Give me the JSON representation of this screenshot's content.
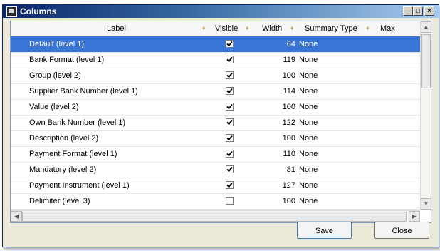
{
  "window": {
    "title": "Columns"
  },
  "grid": {
    "columns": [
      "Label",
      "Visible",
      "Width",
      "Summary Type",
      "Max Length"
    ],
    "rows": [
      {
        "label": "Default (level 1)",
        "visible": true,
        "width": "64",
        "summary": "None"
      },
      {
        "label": "Bank Format (level 1)",
        "visible": true,
        "width": "119",
        "summary": "None"
      },
      {
        "label": "Group (level 2)",
        "visible": true,
        "width": "100",
        "summary": "None"
      },
      {
        "label": "Supplier Bank Number (level 1)",
        "visible": true,
        "width": "114",
        "summary": "None"
      },
      {
        "label": "Value (level 2)",
        "visible": true,
        "width": "100",
        "summary": "None"
      },
      {
        "label": "Own Bank Number (level 1)",
        "visible": true,
        "width": "122",
        "summary": "None"
      },
      {
        "label": "Description (level 2)",
        "visible": true,
        "width": "100",
        "summary": "None"
      },
      {
        "label": "Payment Format (level 1)",
        "visible": true,
        "width": "110",
        "summary": "None"
      },
      {
        "label": "Mandatory (level 2)",
        "visible": true,
        "width": "81",
        "summary": "None"
      },
      {
        "label": "Payment Instrument (level 1)",
        "visible": true,
        "width": "127",
        "summary": "None"
      },
      {
        "label": "Delimiter (level 3)",
        "visible": false,
        "width": "100",
        "summary": "None"
      }
    ],
    "selected_row": 0
  },
  "buttons": {
    "save": "Save",
    "close": "Close"
  },
  "colors": {
    "selection": "#3875d7",
    "titlebar": "#0a246a"
  }
}
